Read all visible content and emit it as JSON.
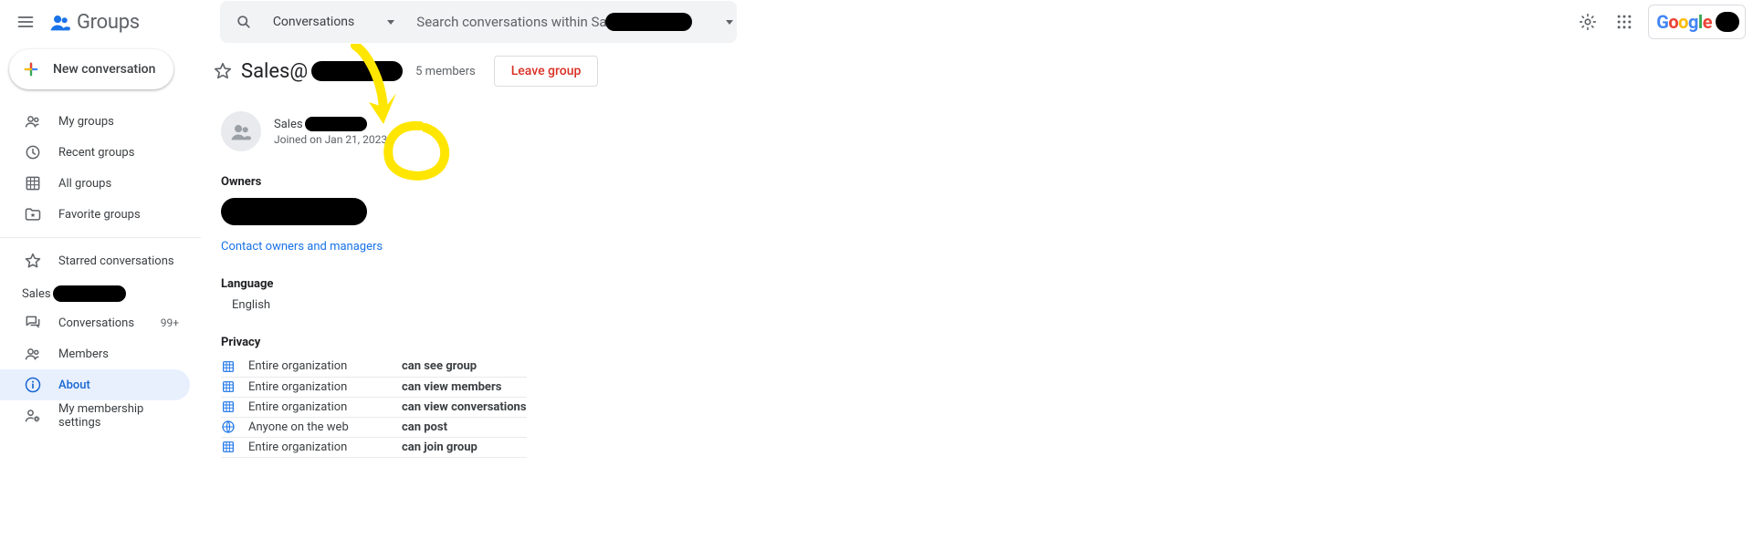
{
  "app_name": "Groups",
  "search": {
    "scope": "Conversations",
    "placeholder": "Search conversations within Sales@"
  },
  "account_brand": "Google",
  "new_conversation_label": "New conversation",
  "sidebar": {
    "top": [
      {
        "icon": "people",
        "label": "My groups"
      },
      {
        "icon": "clock",
        "label": "Recent groups"
      },
      {
        "icon": "org",
        "label": "All groups"
      },
      {
        "icon": "folder-star",
        "label": "Favorite groups"
      }
    ],
    "starred_label": "Starred conversations",
    "group_heading_prefix": "Sales",
    "group_items": [
      {
        "icon": "forum",
        "label": "Conversations",
        "count": "99+"
      },
      {
        "icon": "people",
        "label": "Members"
      },
      {
        "icon": "info",
        "label": "About",
        "active": true
      },
      {
        "icon": "person-gear",
        "label": "My membership settings"
      }
    ]
  },
  "main": {
    "group_title_prefix": "Sales@",
    "members_count": "5 members",
    "leave_label": "Leave group",
    "group_email_prefix": "Sales",
    "joined_text": "Joined on Jan 21, 2023",
    "owners_heading": "Owners",
    "contact_link": "Contact owners and managers",
    "language_heading": "Language",
    "language_value": "English",
    "privacy_heading": "Privacy",
    "privacy": [
      {
        "icon": "org",
        "scope": "Entire organization",
        "perm": "can see group"
      },
      {
        "icon": "org",
        "scope": "Entire organization",
        "perm": "can view members"
      },
      {
        "icon": "org",
        "scope": "Entire organization",
        "perm": "can view conversations"
      },
      {
        "icon": "globe",
        "scope": "Anyone on the web",
        "perm": "can post"
      },
      {
        "icon": "org",
        "scope": "Entire organization",
        "perm": "can join group"
      }
    ]
  }
}
